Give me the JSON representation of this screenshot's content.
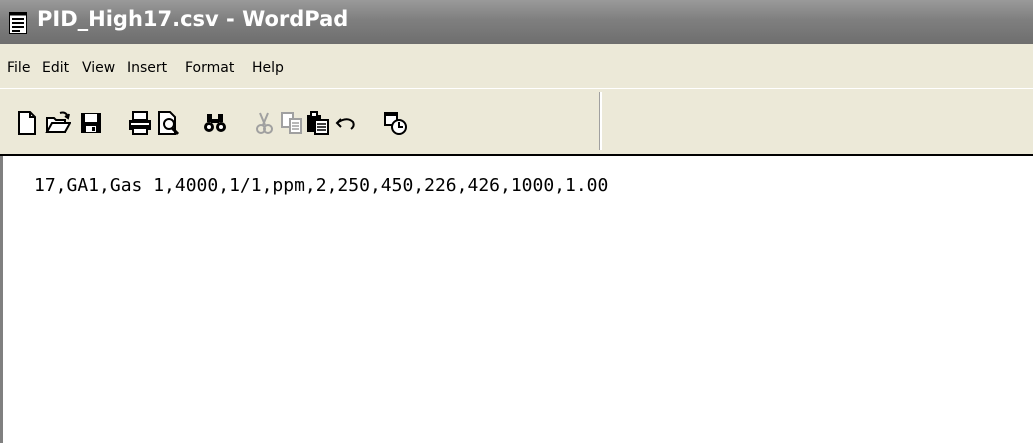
{
  "window": {
    "title": "PID_High17.csv - WordPad",
    "icon": "notepad-document-icon"
  },
  "menu": {
    "items": [
      {
        "label": "File"
      },
      {
        "label": "Edit"
      },
      {
        "label": "View"
      },
      {
        "label": "Insert"
      },
      {
        "label": "Format"
      },
      {
        "label": "Help"
      }
    ]
  },
  "toolbar": {
    "buttons": [
      {
        "icon": "new-document-icon",
        "enabled": true
      },
      {
        "icon": "open-folder-icon",
        "enabled": true
      },
      {
        "icon": "save-disk-icon",
        "enabled": true
      },
      {
        "icon": "print-icon",
        "enabled": true
      },
      {
        "icon": "print-preview-icon",
        "enabled": true
      },
      {
        "icon": "find-binoculars-icon",
        "enabled": true
      },
      {
        "icon": "cut-scissors-icon",
        "enabled": false
      },
      {
        "icon": "copy-icon",
        "enabled": false
      },
      {
        "icon": "paste-icon",
        "enabled": true
      },
      {
        "icon": "undo-icon",
        "enabled": true
      },
      {
        "icon": "insert-date-time-icon",
        "enabled": true
      }
    ]
  },
  "document": {
    "content": "17,GA1,Gas 1,4000,1/1,ppm,2,250,450,226,426,1000,1.00"
  }
}
